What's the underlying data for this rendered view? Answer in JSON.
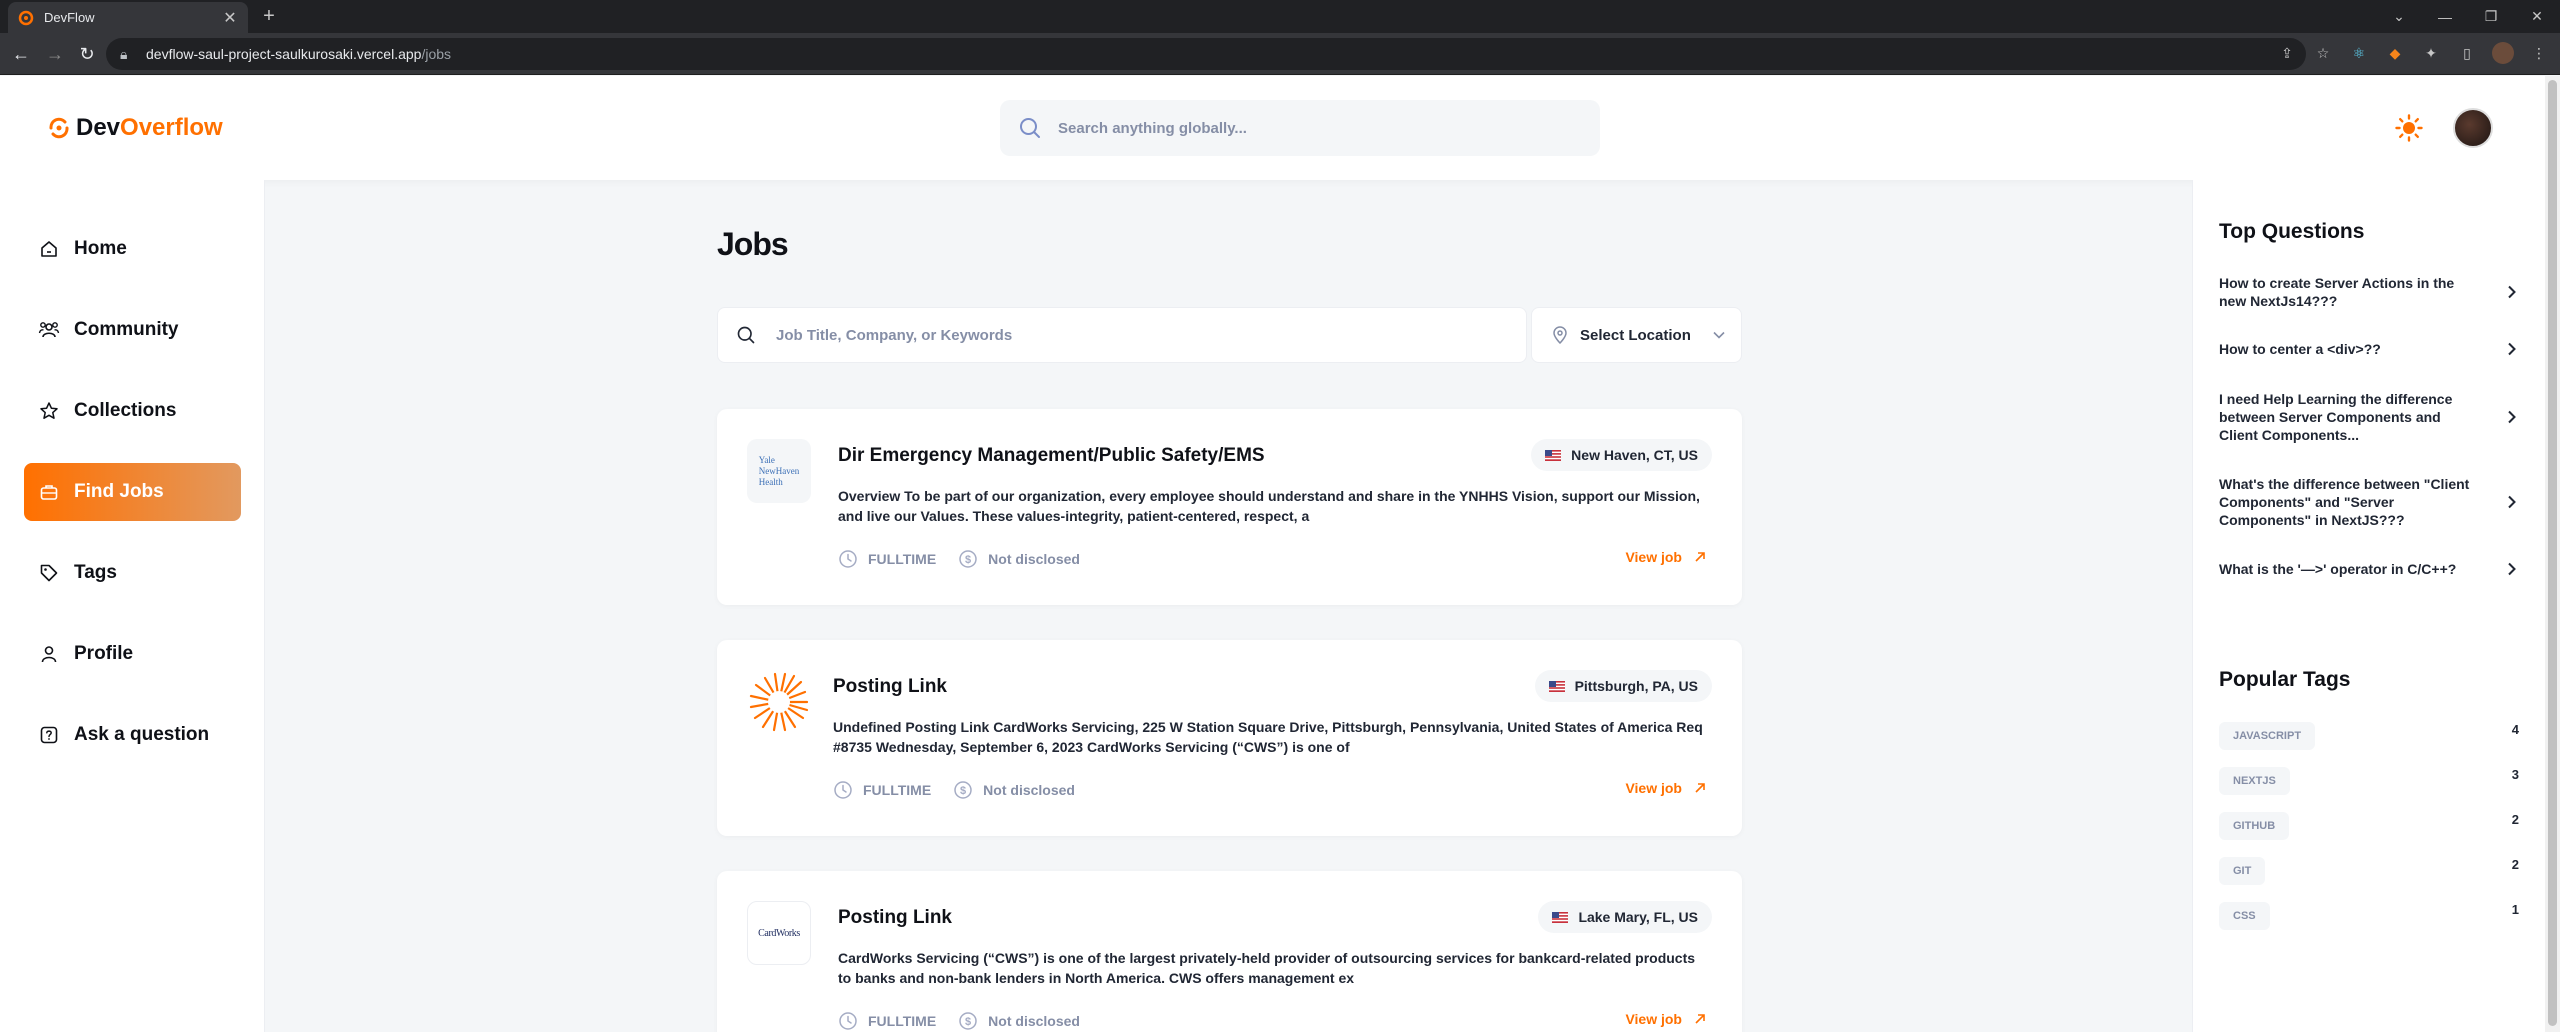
{
  "browser": {
    "tab_title": "DevFlow",
    "url_host": "devflow-saul-project-saulkurosaki.vercel.app",
    "url_path": "/jobs"
  },
  "header": {
    "logo_dev": "Dev",
    "logo_overflow": "Overflow",
    "search_placeholder": "Search anything globally..."
  },
  "sidebar": {
    "items": [
      {
        "label": "Home",
        "icon": "home-icon"
      },
      {
        "label": "Community",
        "icon": "users-icon"
      },
      {
        "label": "Collections",
        "icon": "star-icon"
      },
      {
        "label": "Find Jobs",
        "icon": "suitcase-icon",
        "active": true
      },
      {
        "label": "Tags",
        "icon": "tag-icon"
      },
      {
        "label": "Profile",
        "icon": "user-icon"
      },
      {
        "label": "Ask a question",
        "icon": "question-icon"
      }
    ]
  },
  "main": {
    "title": "Jobs",
    "search_placeholder": "Job Title, Company, or Keywords",
    "location_label": "Select Location",
    "jobs": [
      {
        "title": "Dir Emergency Management/Public Safety/EMS",
        "location": "New Haven, CT, US",
        "logo_lines": [
          "Yale",
          "NewHaven",
          "Health"
        ],
        "description": "Overview To be part of our organization, every employee should understand and share in the YNHHS Vision, support our Mission, and live our Values. These values-integrity, patient-centered, respect, a",
        "employment_type": "FULLTIME",
        "salary": "Not disclosed",
        "view_label": "View job"
      },
      {
        "title": "Posting Link",
        "location": "Pittsburgh, PA, US",
        "logo_lines": [],
        "description": "Undefined Posting Link CardWorks Servicing, 225 W Station Square Drive, Pittsburgh, Pennsylvania, United States of America Req #8735 Wednesday, September 6, 2023 CardWorks Servicing (“CWS”) is one of",
        "employment_type": "FULLTIME",
        "salary": "Not disclosed",
        "view_label": "View job"
      },
      {
        "title": "Posting Link",
        "location": "Lake Mary, FL, US",
        "logo_text": "CardWorks",
        "description": "CardWorks Servicing (“CWS”) is one of the largest privately-held provider of outsourcing services for bankcard-related products to banks and non-bank lenders in North America. CWS offers management ex",
        "employment_type": "FULLTIME",
        "salary": "Not disclosed",
        "view_label": "View job"
      }
    ]
  },
  "right_sidebar": {
    "top_questions_title": "Top Questions",
    "top_questions": [
      "How to create Server Actions in the new NextJs14???",
      "How to center a <div>??",
      "I need Help Learning the difference between Server Components and Client Components...",
      "What's the difference between \"Client Components\" and \"Server Components\" in NextJS???",
      "What is the '—>' operator in C/C++?"
    ],
    "popular_tags_title": "Popular Tags",
    "popular_tags": [
      {
        "name": "JAVASCRIPT",
        "count": "4"
      },
      {
        "name": "NEXTJS",
        "count": "3"
      },
      {
        "name": "GITHUB",
        "count": "2"
      },
      {
        "name": "GIT",
        "count": "2"
      },
      {
        "name": "CSS",
        "count": "1"
      }
    ]
  },
  "colors": {
    "primary": "#ff7000",
    "background": "#f4f6f8",
    "text_muted": "#858ea6"
  }
}
